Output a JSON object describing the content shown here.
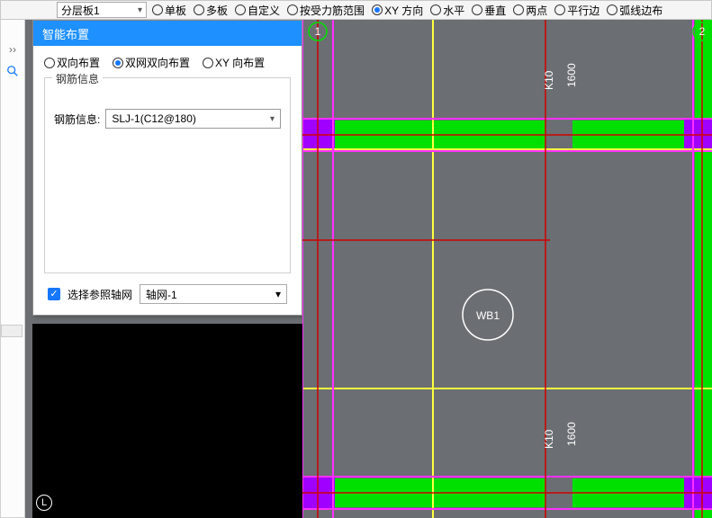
{
  "toolbar": {
    "layer_select": "分层板1",
    "radios": {
      "single": "单板",
      "multi": "多板",
      "custom": "自定义",
      "force": "按受力筋范围",
      "xy": "XY 方向",
      "horiz": "水平",
      "vert": "垂直",
      "two_point": "两点",
      "parallel": "平行边",
      "arc": "弧线边布"
    },
    "selected": "xy"
  },
  "dialog": {
    "title": "智能布置",
    "placement": {
      "bi": "双向布置",
      "double_bi": "双网双向布置",
      "xy": "XY 向布置",
      "selected": "double_bi"
    },
    "fieldset_legend": "钢筋信息",
    "rebar_label": "钢筋信息:",
    "rebar_value": "SLJ-1(C12@180)",
    "axis_checkbox_label": "选择参照轴网",
    "axis_value": "轴网-1"
  },
  "canvas": {
    "grid_marker_1": "1",
    "grid_marker_2": "2",
    "grid_marker_L": "L",
    "slab_label": "WB1",
    "dim_1600_a": "1600",
    "dim_1600_b": "1600",
    "dim_K10_a": "K10",
    "dim_K10_b": "K10"
  }
}
